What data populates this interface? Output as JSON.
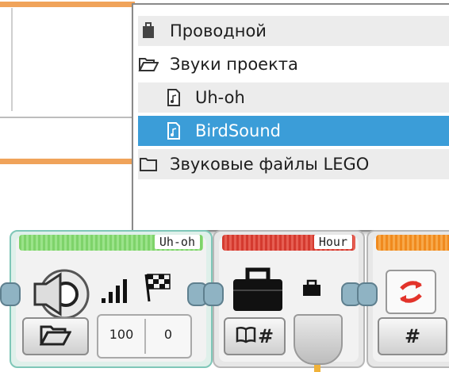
{
  "popup": {
    "items": [
      {
        "label": "Проводной",
        "icon": "briefcase-icon"
      },
      {
        "label": "Звуки проекта",
        "icon": "folder-open-icon"
      },
      {
        "label": "Uh-oh",
        "icon": "sound-file-icon"
      },
      {
        "label": "BirdSound",
        "icon": "sound-file-icon",
        "selected": true
      },
      {
        "label": "Звуковые файлы LEGO",
        "icon": "folder-icon"
      }
    ]
  },
  "blocks": {
    "sound": {
      "title": "Uh-oh",
      "volume": "100",
      "wait": "0",
      "accent": "#7ed36a"
    },
    "timer": {
      "title": "Hour",
      "accent": "#d43a2f"
    },
    "math": {
      "accent": "#f08a1e",
      "symbol": "#"
    },
    "timer_button_symbol": "#"
  },
  "colors": {
    "selection": "#3b9dd8",
    "canvas_line": "#f0a35a"
  }
}
